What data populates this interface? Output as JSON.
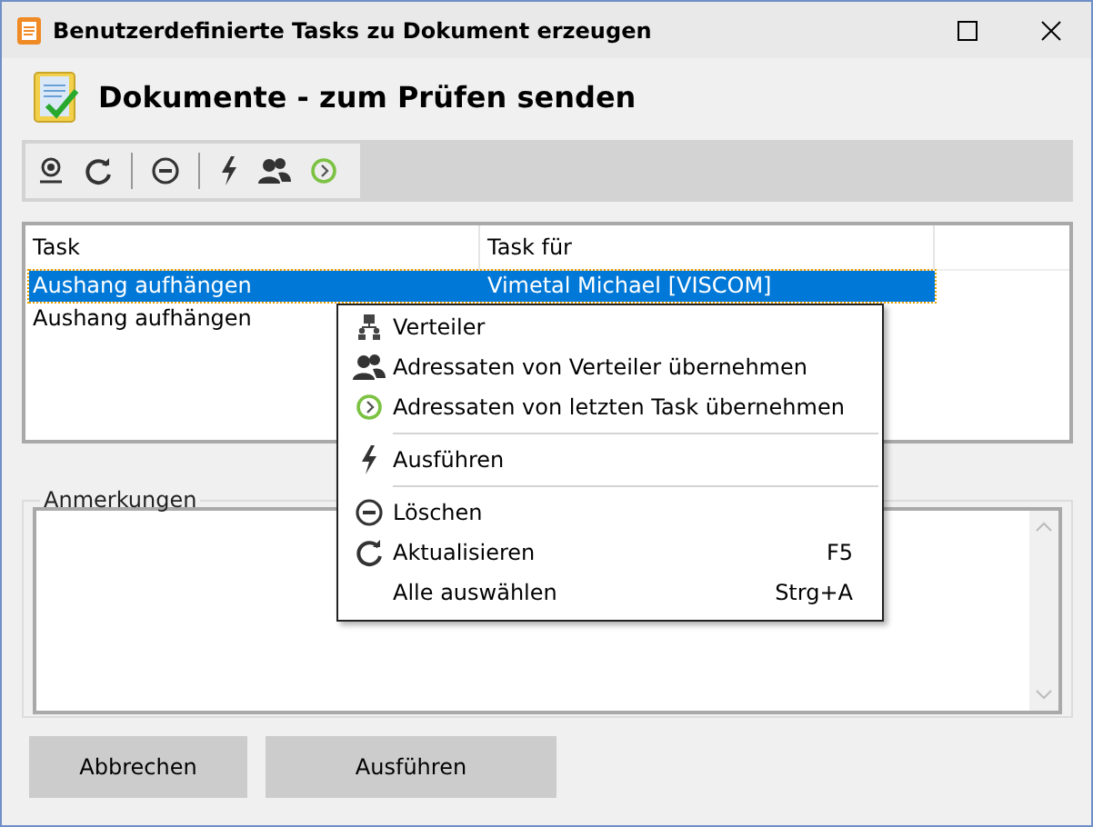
{
  "window": {
    "title": "Benutzerdefinierte Tasks zu Dokument erzeugen"
  },
  "header": {
    "title": "Dokumente - zum Prüfen senden"
  },
  "table": {
    "columns": [
      "Task",
      "Task für"
    ],
    "rows": [
      {
        "cells": [
          "Aushang aufhängen",
          "Vimetal Michael [VISCOM]"
        ],
        "selected": true
      },
      {
        "cells": [
          "Aushang aufhängen",
          ""
        ],
        "selected": false
      }
    ]
  },
  "context_menu": [
    {
      "kind": "item",
      "label": "Verteiler"
    },
    {
      "kind": "item",
      "label": "Adressaten von Verteiler übernehmen"
    },
    {
      "kind": "item",
      "label": "Adressaten von letzten Task übernehmen"
    },
    {
      "kind": "separator"
    },
    {
      "kind": "item",
      "label": "Ausführen"
    },
    {
      "kind": "separator"
    },
    {
      "kind": "item",
      "label": "Löschen"
    },
    {
      "kind": "item",
      "label": "Aktualisieren",
      "shortcut": "F5"
    },
    {
      "kind": "item",
      "label": "Alle auswählen",
      "shortcut": "Strg+A"
    }
  ],
  "notes": {
    "label": "Anmerkungen"
  },
  "buttons": [
    "Abbrechen",
    "Ausführen"
  ]
}
